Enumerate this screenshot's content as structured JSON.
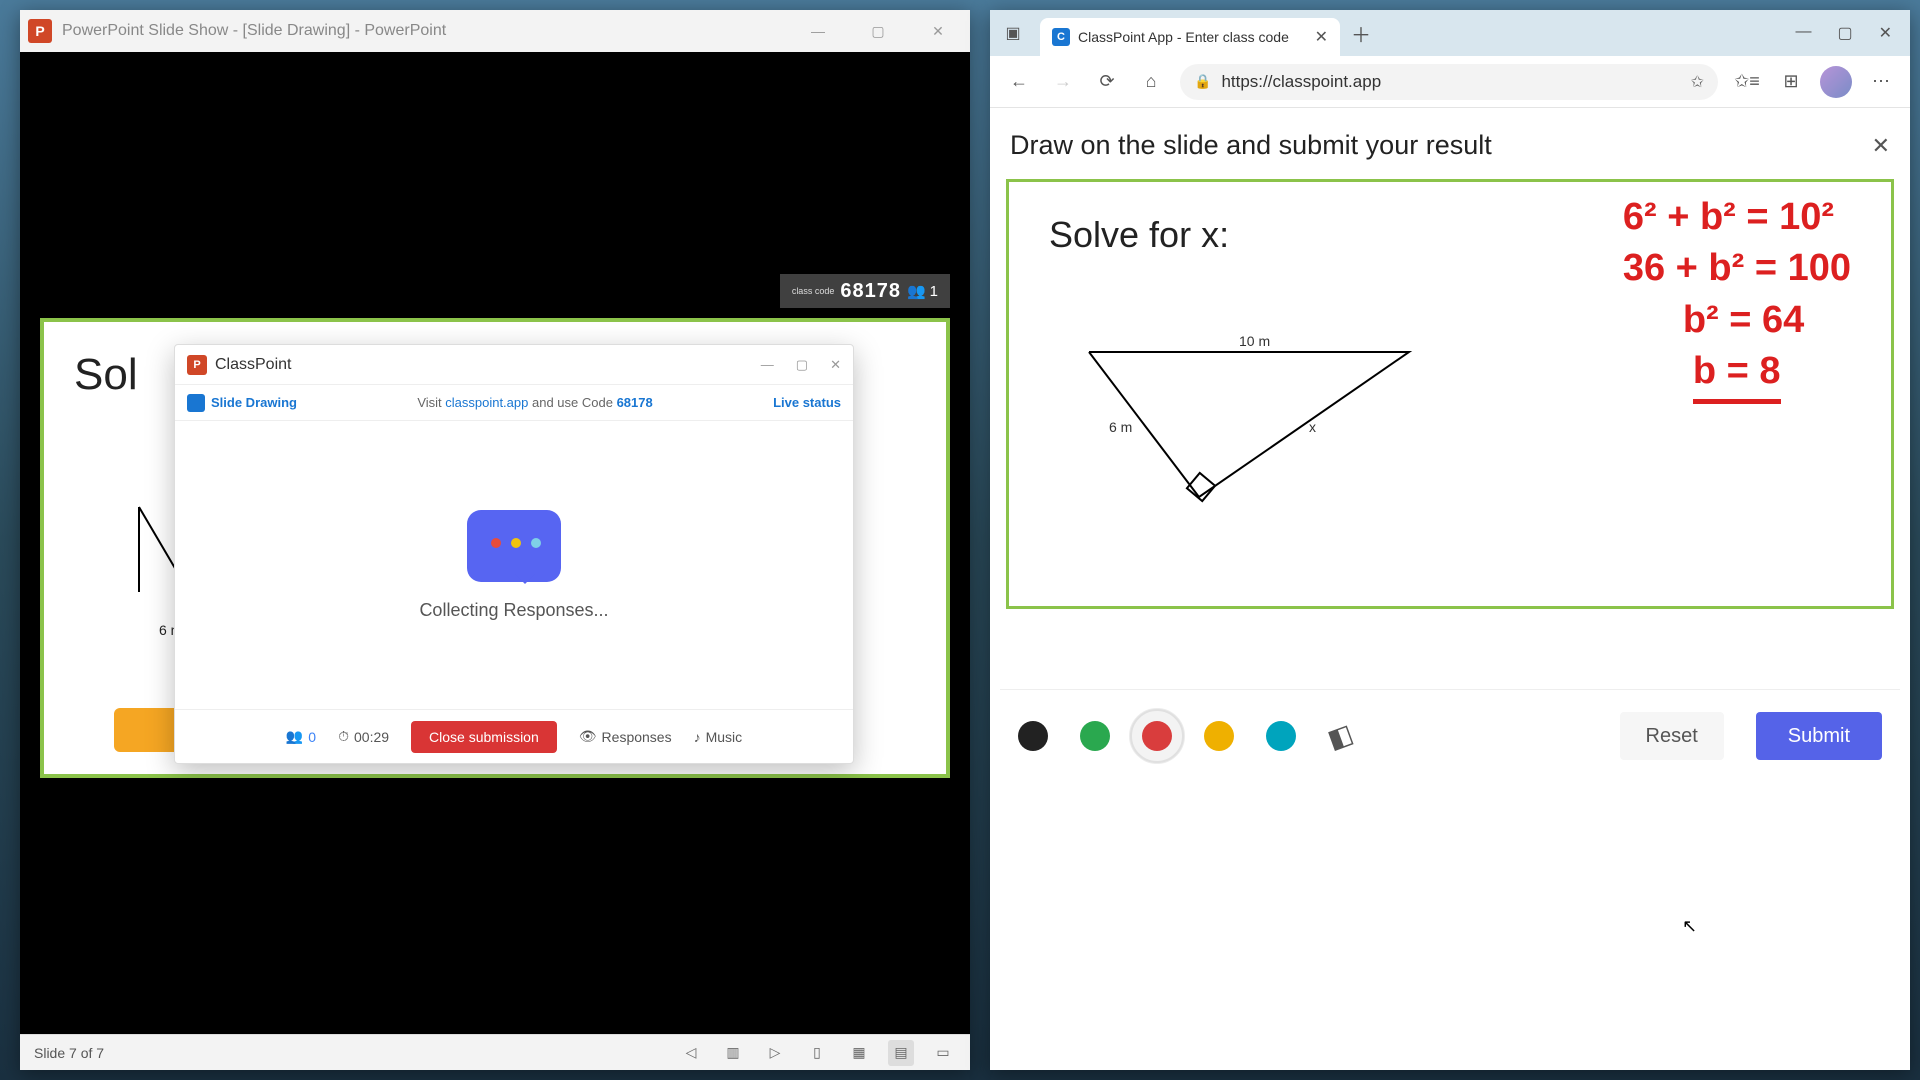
{
  "powerpoint": {
    "window_title": "PowerPoint Slide Show - [Slide Drawing] - PowerPoint",
    "slide_counter": "Slide 7 of 7",
    "slide_title": "Sol",
    "slide_label_6m": "6 m",
    "code_overlay": {
      "label": "class code",
      "code": "68178",
      "participants": "1"
    }
  },
  "classpoint_modal": {
    "brand": "ClassPoint",
    "chip": "Slide Drawing",
    "visit": {
      "pre": "Visit ",
      "domain": "classpoint.app",
      "mid": " and use Code ",
      "code": "68178"
    },
    "live_status": "Live status",
    "status_text": "Collecting Responses...",
    "participants": "0",
    "timer": "00:29",
    "close_label": "Close submission",
    "responses": "Responses",
    "music": "Music"
  },
  "browser": {
    "tab_title": "ClassPoint App - Enter class code",
    "url": "https://classpoint.app"
  },
  "draw_page": {
    "prompt": "Draw on the slide and submit your result",
    "solve_label": "Solve for x:",
    "triangle": {
      "hyp": "10 m",
      "side_a": "6 m",
      "side_x": "x"
    },
    "work_lines": [
      "6² + b² = 10²",
      "36 + b² = 100",
      "b² = 64",
      "b = 8"
    ],
    "reset": "Reset",
    "submit": "Submit",
    "pens": [
      "#222222",
      "#2aa84f",
      "#d93d3d",
      "#efb000",
      "#00a4bd"
    ]
  }
}
